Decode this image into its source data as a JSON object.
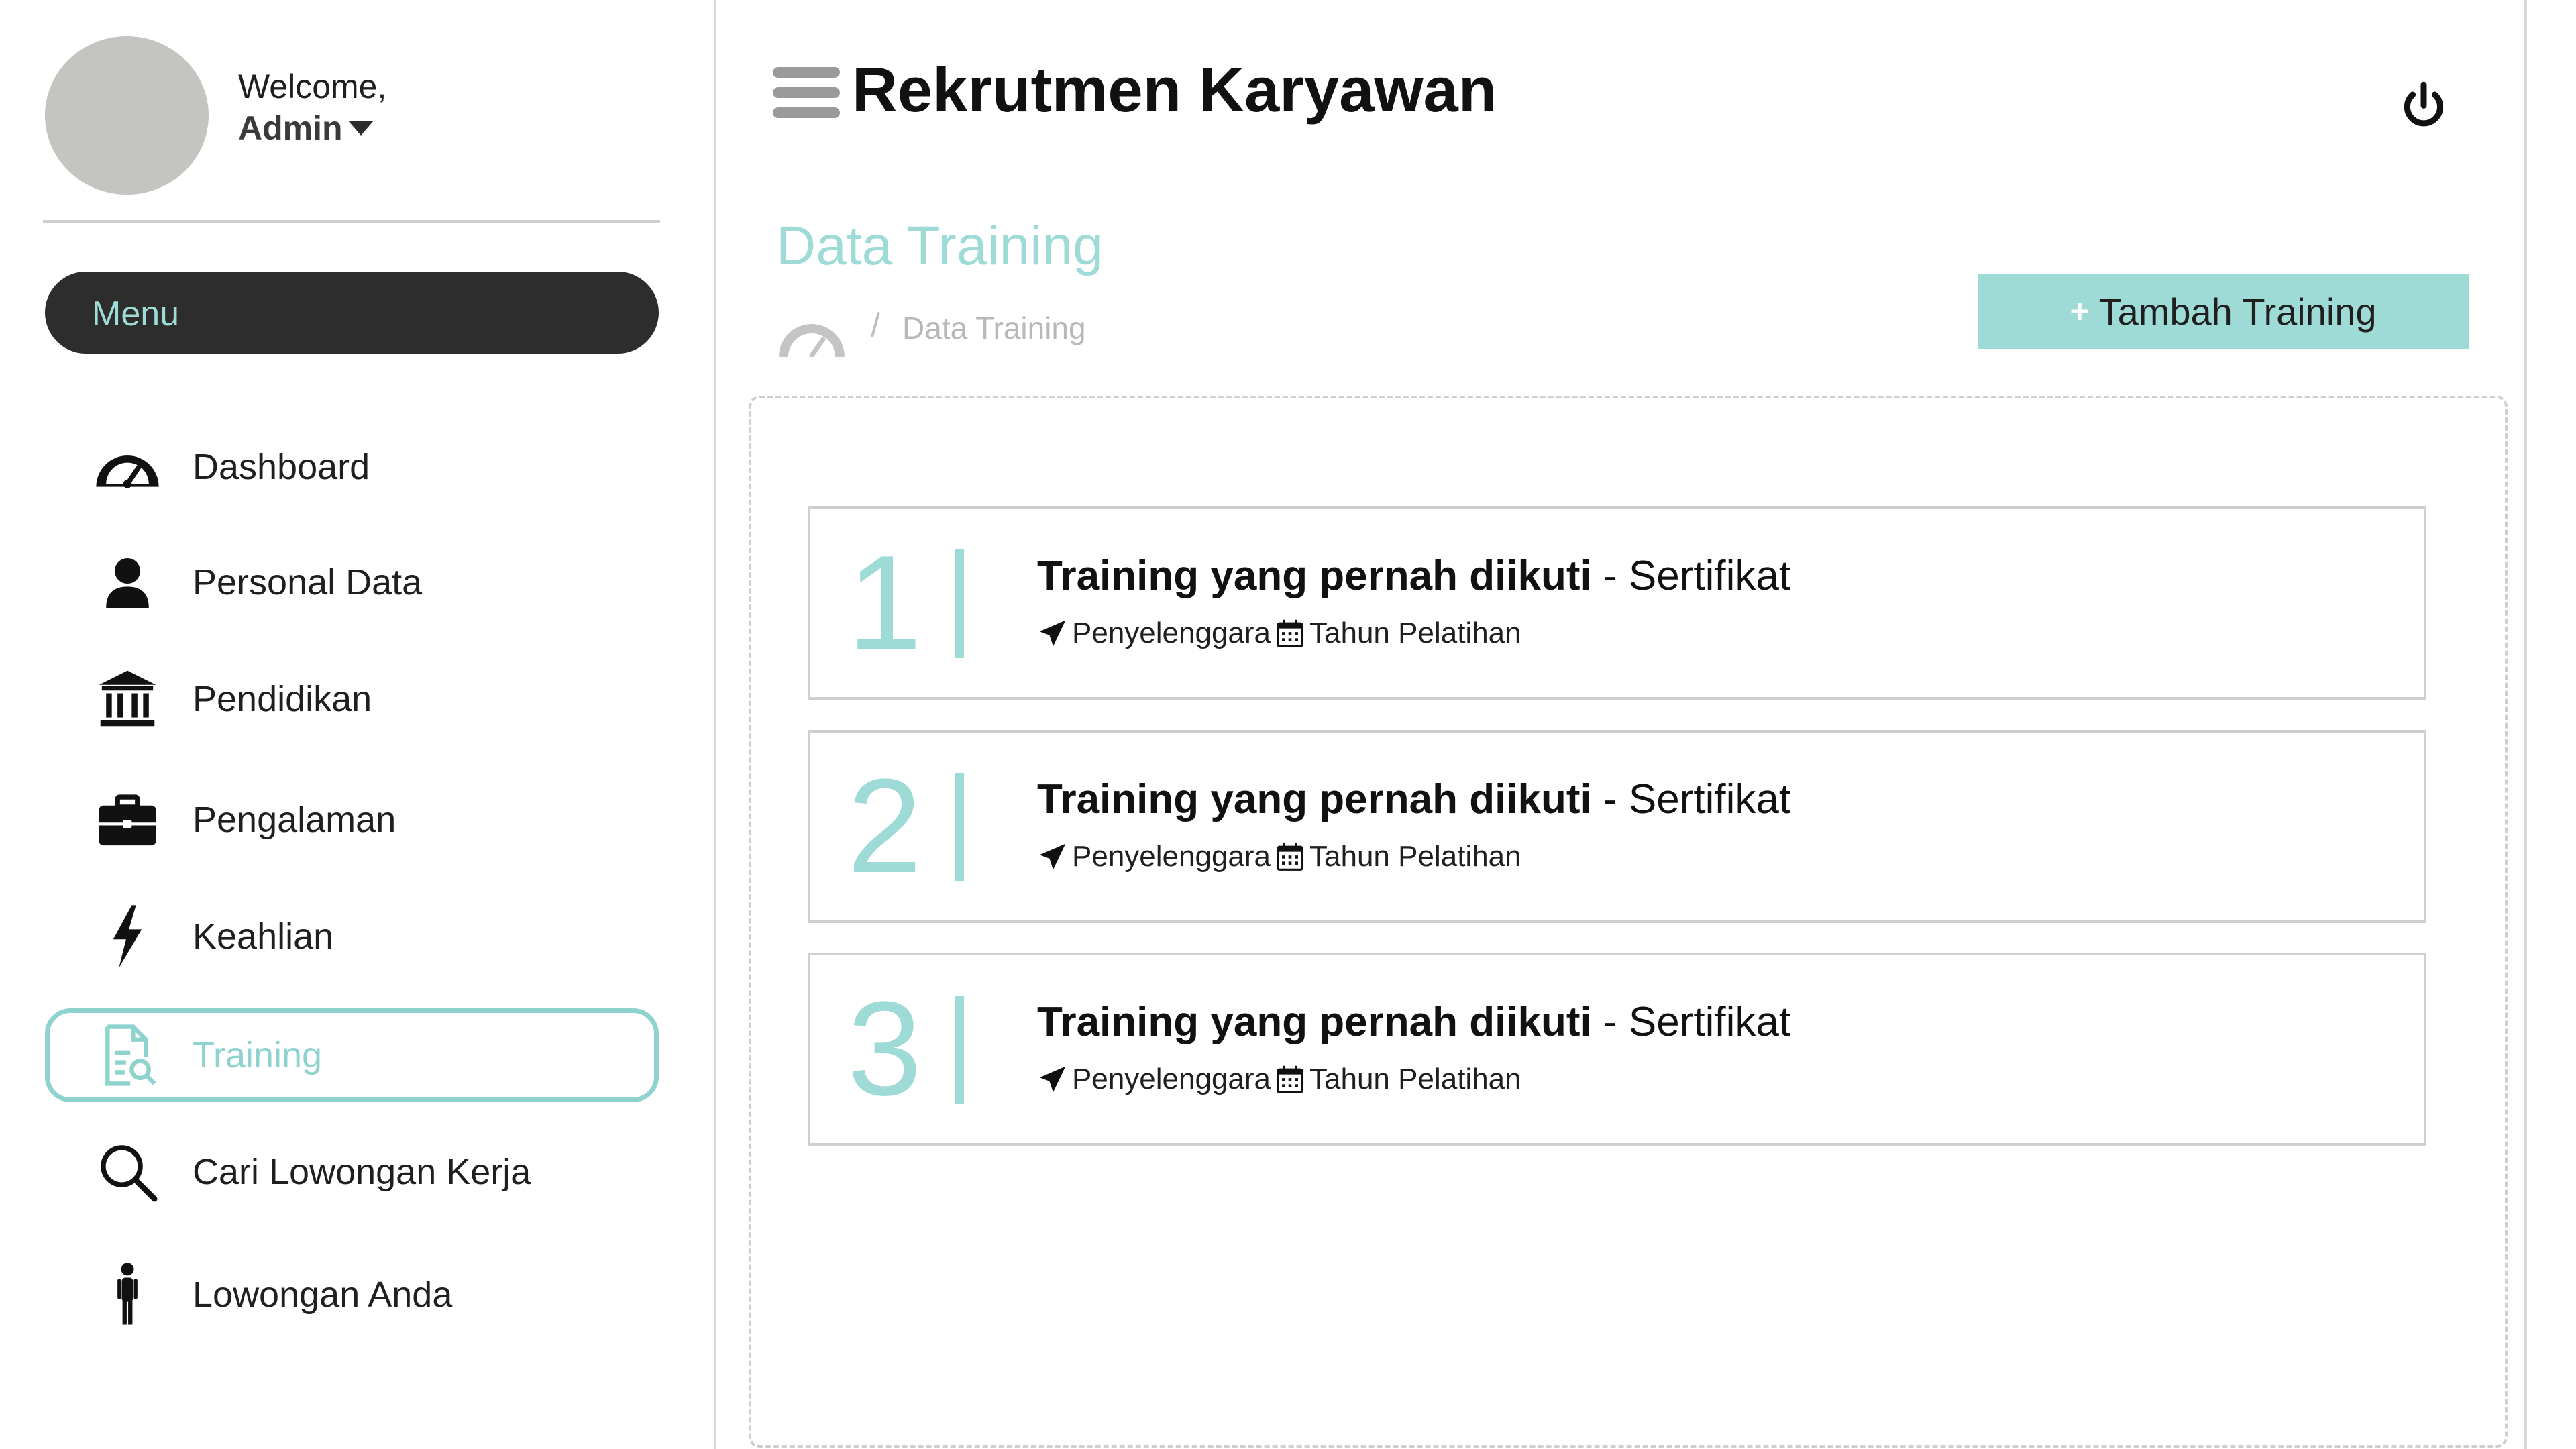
{
  "user": {
    "welcome": "Welcome,",
    "name": "Admin"
  },
  "sidebar": {
    "menu_label": "Menu",
    "items": [
      {
        "label": "Dashboard",
        "icon": "dashboard-gauge-icon"
      },
      {
        "label": "Personal Data",
        "icon": "user-icon"
      },
      {
        "label": "Pendidikan",
        "icon": "institution-icon"
      },
      {
        "label": "Pengalaman",
        "icon": "briefcase-icon"
      },
      {
        "label": "Keahlian",
        "icon": "lightning-icon"
      },
      {
        "label": "Training",
        "icon": "document-search-icon",
        "active": true
      },
      {
        "label": "Cari Lowongan Kerja",
        "icon": "search-icon"
      },
      {
        "label": "Lowongan Anda",
        "icon": "person-standing-icon"
      }
    ]
  },
  "header": {
    "title": "Rekrutmen Karyawan"
  },
  "page": {
    "title": "Data Training",
    "breadcrumb_sep": "/",
    "breadcrumb": "Data Training",
    "add_button_label": "Tambah Training",
    "add_button_icon": "+"
  },
  "trainings": [
    {
      "number": "1",
      "name": "Training yang pernah diikuti",
      "separator": " - ",
      "certificate": "Sertifikat",
      "organizer": "Penyelenggara",
      "year": "Tahun Pelatihan"
    },
    {
      "number": "2",
      "name": "Training yang pernah diikuti",
      "separator": " - ",
      "certificate": "Sertifikat",
      "organizer": "Penyelenggara",
      "year": "Tahun Pelatihan"
    },
    {
      "number": "3",
      "name": "Training yang pernah diikuti",
      "separator": " - ",
      "certificate": "Sertifikat",
      "organizer": "Penyelenggara",
      "year": "Tahun Pelatihan"
    }
  ],
  "colors": {
    "accent": "#9edad6",
    "dark": "#2d2d2d",
    "avatar": "#c4c4c0",
    "border": "#cfcfcf"
  }
}
